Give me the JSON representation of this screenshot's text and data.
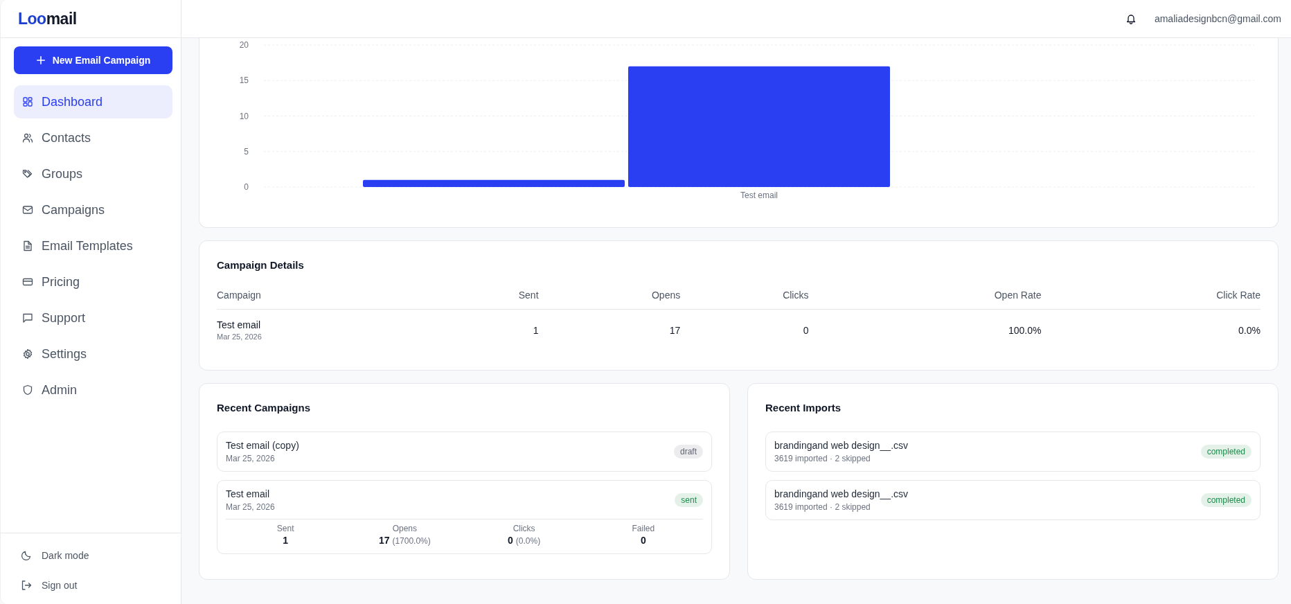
{
  "sidebar": {
    "logo": [
      "Loo",
      "mail"
    ],
    "new_button": {
      "label": "New Email Campaign"
    },
    "items": [
      {
        "label": "Dashboard",
        "selected": true
      },
      {
        "label": "Contacts",
        "selected": false
      },
      {
        "label": "Groups",
        "selected": false
      },
      {
        "label": "Campaigns",
        "selected": false
      },
      {
        "label": "Email Templates",
        "selected": false
      },
      {
        "label": "Pricing",
        "selected": false
      },
      {
        "label": "Support",
        "selected": false
      },
      {
        "label": "Settings",
        "selected": false
      },
      {
        "label": "Admin",
        "selected": false
      }
    ],
    "footer": [
      {
        "label": "Dark mode"
      },
      {
        "label": "Sign out"
      }
    ]
  },
  "header": {
    "email": "amaliadesignbcn@gmail.com"
  },
  "chart": {
    "chart_data": {
      "type": "bar",
      "categories": [
        "Test email"
      ],
      "series": [
        {
          "color": "#2b3ff2",
          "values": [
            1
          ]
        },
        {
          "color": "#2b3ff2",
          "values": [
            17
          ]
        },
        {
          "color": "#2b3ff2",
          "values": [
            0
          ]
        }
      ],
      "ylim": [
        0,
        20
      ],
      "yticks": [
        0,
        5,
        10,
        15,
        20
      ],
      "grid": true
    }
  },
  "campaign_details": {
    "title": "Campaign Details",
    "columns": [
      "Campaign",
      "Sent",
      "Opens",
      "Clicks",
      "Open Rate",
      "Click Rate"
    ],
    "rows": [
      {
        "cells": [
          {
            "text": "Test email",
            "subtext": "Mar 25, 2026"
          },
          "1",
          "17",
          "0",
          "100.0%",
          "0.0%"
        ]
      }
    ]
  },
  "recent_campaigns": {
    "title": "Recent Campaigns",
    "items": [
      {
        "name": "Test email (copy)",
        "date": "Mar 25, 2026",
        "status": {
          "text": "draft",
          "color": "#5f6673"
        }
      },
      {
        "name": "Test email",
        "date": "Mar 25, 2026",
        "status": {
          "text": "sent",
          "color": "#1f8a4c"
        },
        "stats": [
          {
            "label": "Sent",
            "value": "1"
          },
          {
            "label": "Opens",
            "value": "17",
            "extra": "(1700.0%)"
          },
          {
            "label": "Clicks",
            "value": "0",
            "extra": "(0.0%)"
          },
          {
            "label": "Failed",
            "value": "0"
          }
        ]
      }
    ]
  },
  "recent_imports": {
    "title": "Recent Imports",
    "items": [
      {
        "name": "brandingand web design__.csv",
        "detail": "3619 imported · 2 skipped",
        "status": {
          "text": "completed",
          "color": "#1f8a4c"
        }
      },
      {
        "name": "brandingand web design__.csv",
        "detail": "3619 imported · 2 skipped",
        "status": {
          "text": "completed",
          "color": "#1f8a4c"
        }
      }
    ]
  }
}
